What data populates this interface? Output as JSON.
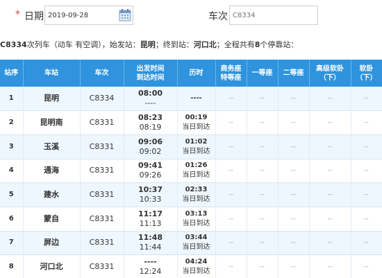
{
  "search": {
    "required_mark": "*",
    "date_label": "日期",
    "date_value": "2019-09-28",
    "train_label": "车次",
    "train_placeholder": "C8334"
  },
  "info": {
    "train_no": "C8334",
    "text1": "次列车（动车 有空调），始发站：",
    "start_station": "昆明",
    "text2": "；终到站：",
    "end_station": "河口北",
    "text3": "；全程共有",
    "stop_count": "8",
    "text4": "个停靠站："
  },
  "table": {
    "headers": {
      "seq": "站序",
      "station": "车站",
      "train": "车次",
      "time_top": "出发时间",
      "time_bot": "到达时间",
      "duration": "历时",
      "business_top": "商务座",
      "business_bot": "特等座",
      "first": "一等座",
      "second": "二等座",
      "soft_sleeper_top": "高级软卧",
      "soft_sleeper_bot": "（下）",
      "soft_top": "软卧",
      "soft_bot": "（下）"
    },
    "rows": [
      {
        "seq": "1",
        "station": "昆明",
        "train": "C8334",
        "dep": "08:00",
        "arr": "----",
        "dur": "----",
        "dur_note": "",
        "business": "--",
        "first": "--",
        "second": "--",
        "adv_soft": "--",
        "soft": "--"
      },
      {
        "seq": "2",
        "station": "昆明南",
        "train": "C8331",
        "dep": "08:23",
        "arr": "08:19",
        "dur": "00:19",
        "dur_note": "当日到达",
        "business": "--",
        "first": "--",
        "second": "--",
        "adv_soft": "--",
        "soft": "--"
      },
      {
        "seq": "3",
        "station": "玉溪",
        "train": "C8331",
        "dep": "09:06",
        "arr": "09:02",
        "dur": "01:02",
        "dur_note": "当日到达",
        "business": "--",
        "first": "--",
        "second": "--",
        "adv_soft": "--",
        "soft": "--"
      },
      {
        "seq": "4",
        "station": "通海",
        "train": "C8331",
        "dep": "09:41",
        "arr": "09:26",
        "dur": "01:26",
        "dur_note": "当日到达",
        "business": "--",
        "first": "--",
        "second": "--",
        "adv_soft": "--",
        "soft": "--"
      },
      {
        "seq": "5",
        "station": "建水",
        "train": "C8331",
        "dep": "10:37",
        "arr": "10:33",
        "dur": "02:33",
        "dur_note": "当日到达",
        "business": "--",
        "first": "--",
        "second": "--",
        "adv_soft": "--",
        "soft": "--"
      },
      {
        "seq": "6",
        "station": "蒙自",
        "train": "C8331",
        "dep": "11:17",
        "arr": "11:13",
        "dur": "03:13",
        "dur_note": "当日到达",
        "business": "--",
        "first": "--",
        "second": "--",
        "adv_soft": "--",
        "soft": "--"
      },
      {
        "seq": "7",
        "station": "屏边",
        "train": "C8331",
        "dep": "11:48",
        "arr": "11:44",
        "dur": "03:44",
        "dur_note": "当日到达",
        "business": "--",
        "first": "--",
        "second": "--",
        "adv_soft": "--",
        "soft": "--"
      },
      {
        "seq": "8",
        "station": "河口北",
        "train": "C8331",
        "dep": "----",
        "arr": "12:24",
        "dur": "04:24",
        "dur_note": "当日到达",
        "business": "--",
        "first": "--",
        "second": "--",
        "adv_soft": "--",
        "soft": "--"
      }
    ]
  },
  "colors": {
    "header_blue": "#2f93dd",
    "row_odd": "#eef6fe",
    "required_red": "#e4393c"
  },
  "icons": {
    "calendar": "calendar-icon"
  }
}
